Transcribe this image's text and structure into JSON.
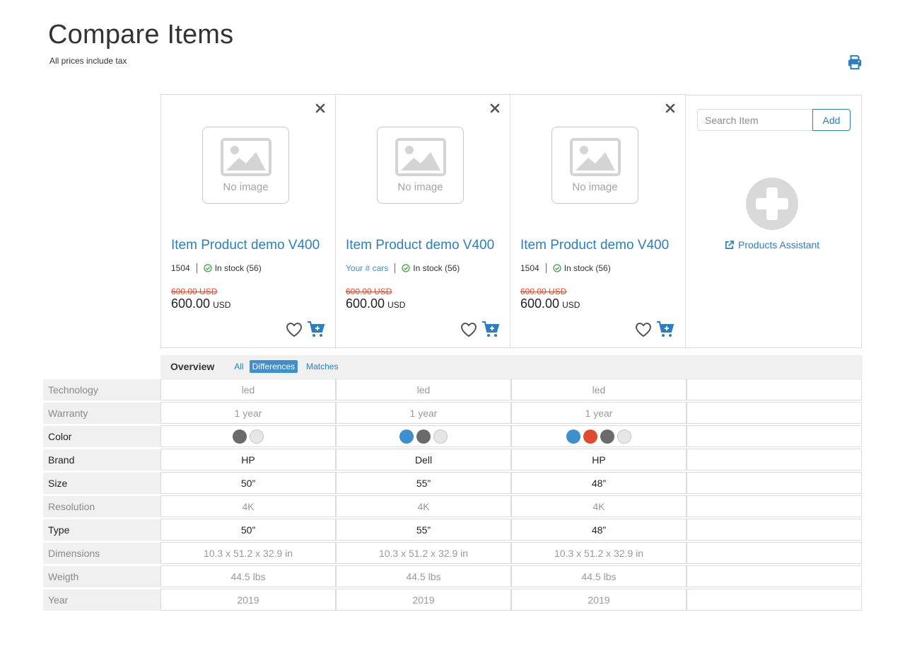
{
  "header": {
    "title": "Compare Items",
    "subtitle": "All prices include tax",
    "print_icon": "print-icon"
  },
  "products": [
    {
      "name": "Item Product demo V400",
      "code": "1504",
      "code_is_link": false,
      "stock": "In stock (56)",
      "old_price": "600.00 USD",
      "price": "600.00",
      "currency": "USD",
      "no_image": "No image"
    },
    {
      "name": "Item Product demo V400",
      "code": "Your # cars",
      "code_is_link": true,
      "stock": "In stock (56)",
      "old_price": "600.00 USD",
      "price": "600.00",
      "currency": "USD",
      "no_image": "No image"
    },
    {
      "name": "Item Product demo V400",
      "code": "1504",
      "code_is_link": false,
      "stock": "In stock (56)",
      "old_price": "600.00 USD",
      "price": "600.00",
      "currency": "USD",
      "no_image": "No image"
    }
  ],
  "add_panel": {
    "search_placeholder": "Search Item",
    "add_label": "Add",
    "assistant_label": "Products Assistant"
  },
  "overview": {
    "title": "Overview",
    "filters": [
      "All",
      "Differences",
      "Matches"
    ],
    "active_filter": "Differences"
  },
  "specs": [
    {
      "label": "Technology",
      "values": [
        "led",
        "led",
        "led"
      ],
      "differs": false
    },
    {
      "label": "Warranty",
      "values": [
        "1 year",
        "1 year",
        "1 year"
      ],
      "differs": false
    },
    {
      "label": "Color",
      "type": "colors",
      "differs": true,
      "values": [
        [
          "#6b6b6b",
          "#e6e6e6"
        ],
        [
          "#3d8fd1",
          "#6b6b6b",
          "#e6e6e6"
        ],
        [
          "#3d8fd1",
          "#e04a2f",
          "#6b6b6b",
          "#e6e6e6"
        ]
      ]
    },
    {
      "label": "Brand",
      "values": [
        "HP",
        "Dell",
        "HP"
      ],
      "differs": true
    },
    {
      "label": "Size",
      "values": [
        "50”",
        "55”",
        "48”"
      ],
      "differs": true
    },
    {
      "label": "Resolution",
      "values": [
        "4K",
        "4K",
        "4K"
      ],
      "differs": false
    },
    {
      "label": "Type",
      "values": [
        "50”",
        "55”",
        "48”"
      ],
      "differs": true
    },
    {
      "label": "Dimensions",
      "values": [
        "10.3 x 51.2 x 32.9 in",
        "10.3 x 51.2 x 32.9 in",
        "10.3 x 51.2 x 32.9 in"
      ],
      "differs": false
    },
    {
      "label": "Weigth",
      "values": [
        "44.5 lbs",
        "44.5 lbs",
        "44.5 lbs"
      ],
      "differs": false
    },
    {
      "label": "Year",
      "values": [
        "2019",
        "2019",
        "2019"
      ],
      "differs": false
    }
  ],
  "colors": {
    "accent": "#2b7fc0",
    "sale": "#e04a2f",
    "stock": "#3aa34a"
  }
}
